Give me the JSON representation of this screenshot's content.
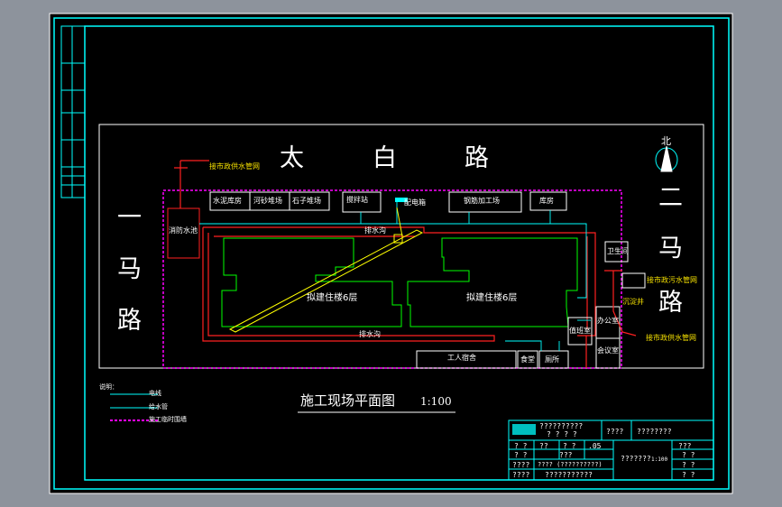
{
  "drawing_title": "施工现场平面图",
  "drawing_scale": "1:100",
  "roads": {
    "north": [
      "太",
      "白",
      "路"
    ],
    "west": [
      "一",
      "马",
      "路"
    ],
    "east": [
      "二",
      "马",
      "路"
    ]
  },
  "north_label": "北",
  "facilities": {
    "cement_store": "水泥库房",
    "sand_yard": "河砂堆场",
    "stone_yard": "石子堆场",
    "mixer_room": "搅拌站",
    "distribution_box": "配电箱",
    "steel_shed": "钢筋加工场",
    "warehouse": "库房",
    "water_tank": "消防水池",
    "drain_top": "排水沟",
    "drain_bottom": "排水沟",
    "building_left": "拟建住楼6层",
    "building_right": "拟建住楼6层",
    "toilet": "卫生间",
    "office": "办公室",
    "meeting_room": "会议室",
    "duty_room": "值班室",
    "dormitory": "工人宿舍",
    "canteen": "食堂",
    "bathroom": "厕所"
  },
  "annotations": {
    "water_supply_top": "接市政供水管网",
    "water_supply_bottom": "接市政供水管网",
    "sewage": "接市政污水管网",
    "septic": "沉淀井"
  },
  "legend": {
    "heading": "说明：",
    "items": [
      "电线",
      "给水管",
      "施工临时围墙"
    ]
  },
  "title_block": {
    "company": "??????????",
    "company_sub": "?  ?  ?  ?",
    "project_label": "????",
    "project_name": "????????",
    "drawing_name": "???????",
    "scale_value": "1:100",
    "rows": [
      [
        "?  ?",
        "??",
        "?   ?",
        ".05"
      ],
      [
        "?  ?",
        "???",
        "",
        ""
      ],
      [
        "????",
        "????  (??????????)",
        "",
        ""
      ],
      [
        "????",
        "???????????",
        "",
        ""
      ]
    ],
    "right_cells": [
      "???",
      "?  ?",
      "?  ?",
      "?  ?"
    ]
  },
  "colors": {
    "frame": "#00ffff",
    "paper": "#000000",
    "wire": "#ffff00",
    "water": "#00ffff",
    "drain": "#ff0000",
    "fence": "#ff00ff",
    "building": "#00ff00",
    "text": "#ffffff"
  }
}
